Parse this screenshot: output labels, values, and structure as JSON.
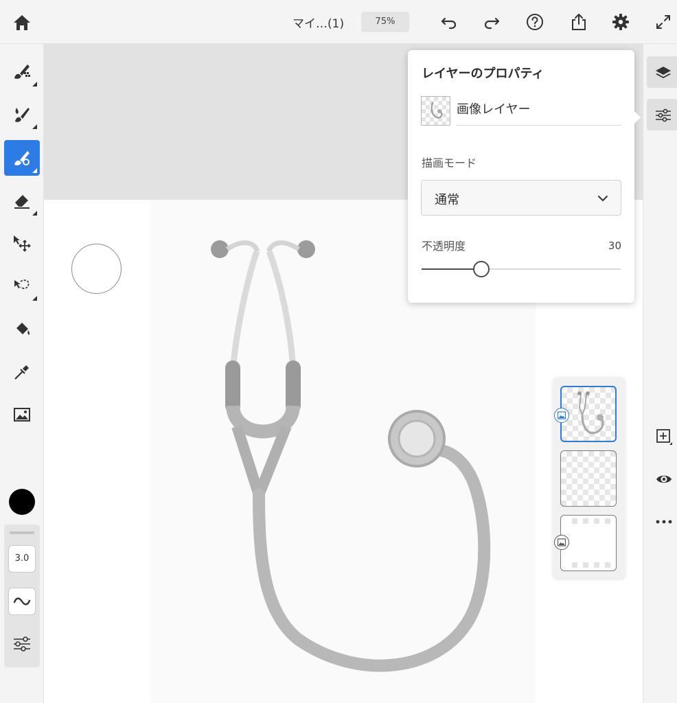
{
  "topbar": {
    "document_title": "マイ…(1)",
    "zoom_level": "75%"
  },
  "toolbar": {
    "tools": [
      "pixel-brush-icon",
      "live-brush-icon",
      "vector-brush-icon",
      "eraser-icon",
      "move-transform-icon",
      "lasso-selection-icon",
      "fill-bucket-icon",
      "eyedropper-icon",
      "image-place-icon"
    ],
    "active_tool": "vector-brush-icon",
    "brush_color": "#000000",
    "brush_size": "3.0"
  },
  "properties": {
    "title": "レイヤーのプロパティ",
    "layer_name": "画像レイヤー",
    "blend_mode_label": "描画モード",
    "blend_mode_value": "通常",
    "opacity_label": "不透明度",
    "opacity_value": "30",
    "opacity_fraction": 0.3
  },
  "layers_panel": {
    "layers": [
      {
        "type": "image-layer",
        "selected": true
      },
      {
        "type": "vector-layer",
        "selected": false
      },
      {
        "type": "background-layer",
        "selected": false
      }
    ]
  },
  "colors": {
    "accent": "#2d7be5",
    "toolbar_bg": "#f4f4f4",
    "canvas_bg": "#e2e2e2"
  }
}
